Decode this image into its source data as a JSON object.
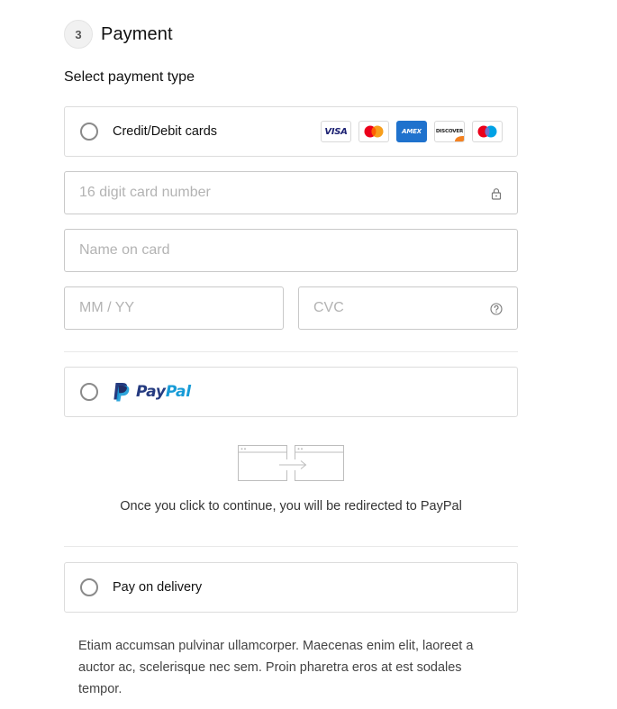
{
  "step": {
    "number": "3",
    "title": "Payment"
  },
  "payment_type_label": "Select payment type",
  "options": {
    "card": {
      "label": "Credit/Debit cards",
      "logos": [
        {
          "name": "visa",
          "text": "VISA"
        },
        {
          "name": "mastercard",
          "text": ""
        },
        {
          "name": "amex",
          "text": "AMEX"
        },
        {
          "name": "discover",
          "text": "DISCOVER"
        },
        {
          "name": "maestro",
          "text": ""
        }
      ]
    },
    "paypal": {
      "label_part1": "Pay",
      "label_part2": "Pal"
    },
    "delivery": {
      "label": "Pay on delivery"
    }
  },
  "fields": {
    "card_number": {
      "placeholder": "16 digit card number",
      "icon": "lock-icon"
    },
    "name_on_card": {
      "placeholder": "Name on card"
    },
    "expiry": {
      "placeholder": "MM / YY"
    },
    "cvc": {
      "placeholder": "CVC",
      "icon": "help-icon"
    }
  },
  "paypal_redirect_text": "Once you click to continue, you will be redirected to PayPal",
  "delivery_description": "Etiam accumsan pulvinar ullamcorper. Maecenas enim elit, laoreet a auctor ac, scelerisque nec sem. Proin pharetra eros at est sodales tempor.",
  "colors": {
    "paypal_dark": "#253b80",
    "paypal_light": "#179bd7",
    "amex_blue": "#1f72cd",
    "visa_blue": "#1a1f71",
    "mastercard_red": "#eb001b",
    "mastercard_orange": "#f79e1b"
  }
}
